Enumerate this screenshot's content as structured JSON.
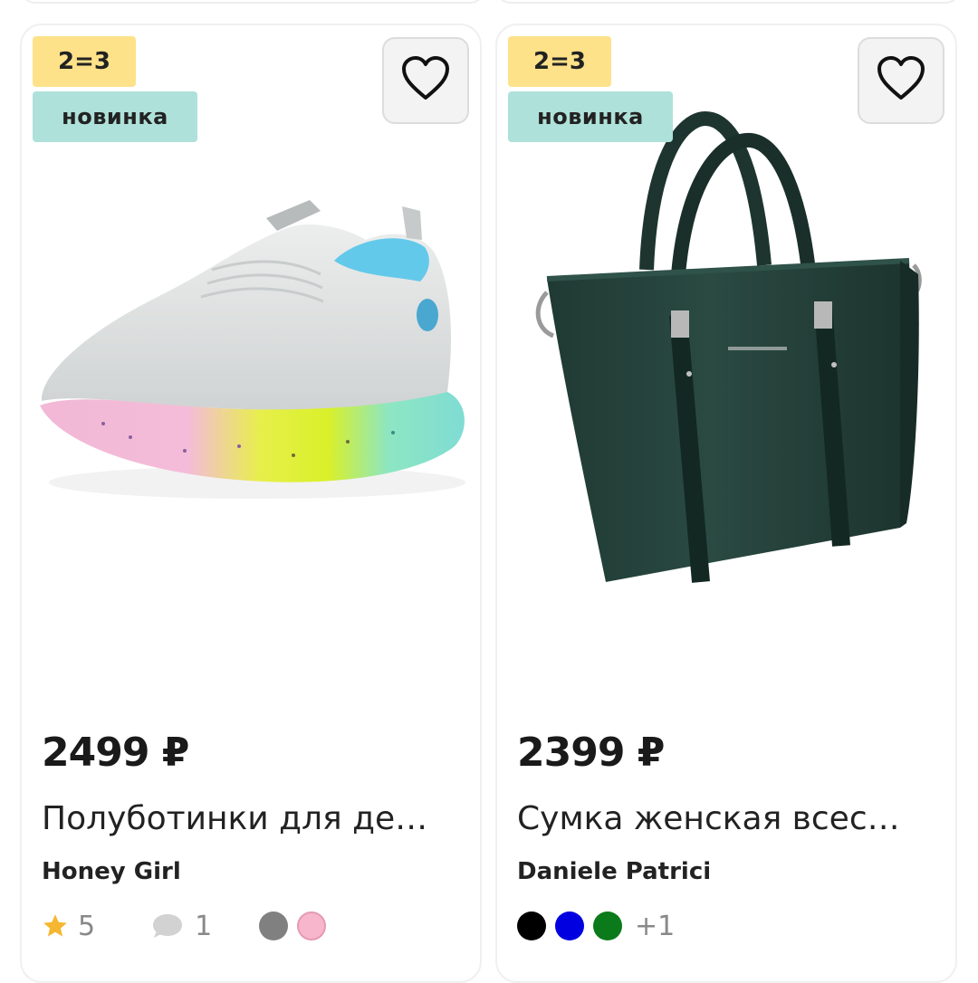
{
  "products": [
    {
      "promo_badge": "2=3",
      "new_badge": "новинка",
      "price": "2499 ₽",
      "title": "Полуботинки для де…",
      "brand": "Honey Girl",
      "rating": "5",
      "reviews": "1",
      "colors": [
        "#808080",
        "#f7b6cc"
      ]
    },
    {
      "promo_badge": "2=3",
      "new_badge": "новинка",
      "price": "2399 ₽",
      "title": "Сумка женская всес…",
      "brand": "Daniele Patrici",
      "colors": [
        "#000000",
        "#0000e0",
        "#0b7a1a"
      ],
      "more_colors": "+1"
    }
  ],
  "colors": {
    "promo_badge_bg": "#fde28a",
    "new_badge_bg": "#aee1d9",
    "star": "#f5b731",
    "comment_icon": "#d2d2d2"
  }
}
